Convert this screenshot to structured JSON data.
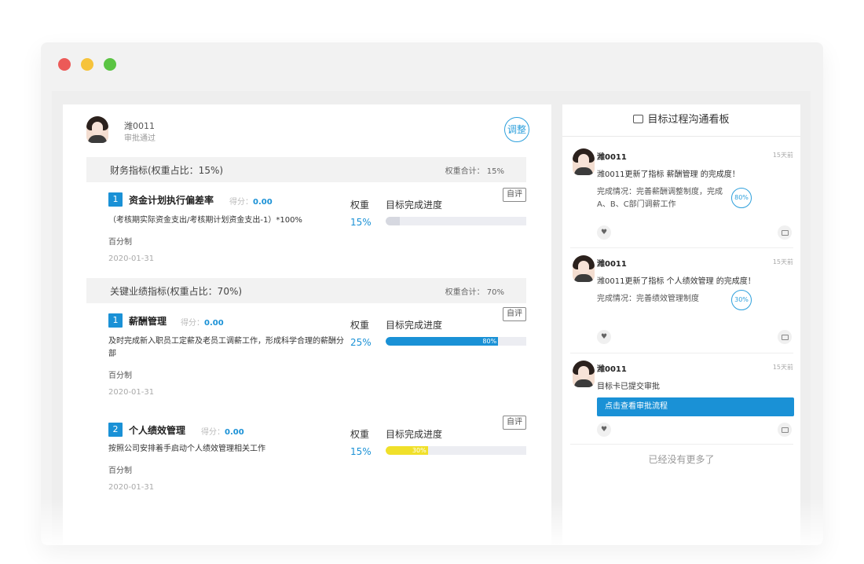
{
  "header": {
    "name": "潍0011",
    "status": "审批通过",
    "adjust_label": "调整"
  },
  "sections": [
    {
      "title": "财务指标(权重占比：15%)",
      "sum": "权重合计： 15%",
      "items": [
        {
          "num": "1",
          "name": "资金计划执行偏差率",
          "score_label": "得分：",
          "score": "0.00",
          "desc": "（考核期实际资金支出/考核期计划资金支出-1）*100%",
          "sub": "百分制",
          "date": "2020-01-31",
          "weight_label": "权重",
          "weight": "15%",
          "progress_label": "目标完成进度",
          "progress": 0.0,
          "progress_text": "0%",
          "progress_color": "#d6d8e0",
          "self_eval": "自评"
        }
      ]
    },
    {
      "title": "关键业绩指标(权重占比：70%)",
      "sum": "权重合计： 70%",
      "items": [
        {
          "num": "1",
          "name": "薪酬管理",
          "score_label": "得分：",
          "score": "0.00",
          "desc": "及时完成新入职员工定薪及老员工调薪工作，形成科学合理的薪酬分部",
          "sub": "百分制",
          "date": "2020-01-31",
          "weight_label": "权重",
          "weight": "25%",
          "progress_label": "目标完成进度",
          "progress": 0.8,
          "progress_text": "80%",
          "progress_color": "#1a91d6",
          "self_eval": "自评"
        },
        {
          "num": "2",
          "name": "个人绩效管理",
          "score_label": "得分：",
          "score": "0.00",
          "desc": "按照公司安排着手启动个人绩效管理相关工作",
          "sub": "百分制",
          "date": "2020-01-31",
          "weight_label": "权重",
          "weight": "15%",
          "progress_label": "目标完成进度",
          "progress": 0.3,
          "progress_text": "30%",
          "progress_color": "#f0e02a",
          "self_eval": "自评"
        }
      ]
    }
  ],
  "board": {
    "title": "目标过程沟通看板",
    "posts": [
      {
        "name": "潍0011",
        "time": "15天前",
        "message": "潍0011更新了指标 薪酬管理 的完成度！",
        "detail": "完成情况：完善薪酬调整制度，完成A、B、C部门调薪工作",
        "percent": "80%"
      },
      {
        "name": "潍0011",
        "time": "15天前",
        "message": "潍0011更新了指标 个人绩效管理 的完成度！",
        "detail": "完成情况：完善绩效管理制度",
        "percent": "30%"
      },
      {
        "name": "潍0011",
        "time": "15天前",
        "message": "目标卡已提交审批",
        "button": "点击查看审批流程"
      }
    ],
    "no_more": "已经没有更多了"
  },
  "colors": {
    "accent": "#1a91d6",
    "yellow": "#f0e02a"
  }
}
